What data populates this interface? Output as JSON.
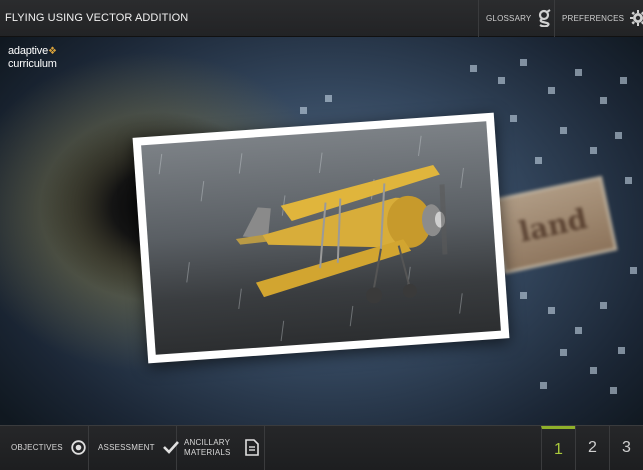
{
  "header": {
    "title": "FLYING USING VECTOR ADDITION",
    "glossary_label": "GLOSSARY",
    "preferences_label": "PREFERENCES"
  },
  "stage": {
    "logo_line1": "adaptive",
    "logo_line2": "curriculum",
    "plaque_text": "land"
  },
  "footer": {
    "objectives_label": "OBJECTIVES",
    "assessment_label": "ASSESSMENT",
    "ancillary_line1": "ANCILLARY",
    "ancillary_line2": "MATERIALS",
    "pages": [
      "1",
      "2",
      "3"
    ],
    "active_page": "1"
  },
  "icons": {
    "glossary": "glossary-g-icon",
    "preferences": "gear-icon",
    "objectives": "target-icon",
    "assessment": "checkmark-icon",
    "ancillary": "document-icon"
  },
  "colors": {
    "accent_active_page": "#a9c93c",
    "logo_accent": "#d9a23a"
  }
}
